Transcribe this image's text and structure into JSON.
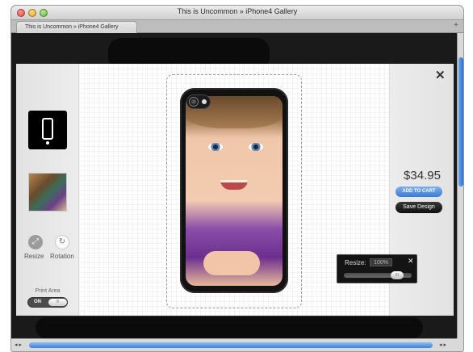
{
  "window": {
    "title": "This is Uncommon » iPhone4 Gallery"
  },
  "tabs": {
    "active_label": "This is Uncommon » iPhone4 Gallery",
    "add_symbol": "+"
  },
  "editor": {
    "close_symbol": "✕",
    "tools": {
      "resize_label": "Resize",
      "rotation_label": "Rotation",
      "resize_icon": "⤢",
      "rotation_icon": "↻"
    },
    "print_area": {
      "label": "Print Area",
      "toggle_on": "ON",
      "toggle_knob": "III",
      "state": "on"
    },
    "price": "$34.95",
    "add_to_cart_label": "ADD TO CART",
    "save_design_label": "Save Design"
  },
  "resize_popup": {
    "label": "Resize:",
    "value": "100%",
    "close_symbol": "✕",
    "slider_knob": "III",
    "slider_level": 0.85
  },
  "scrollbar": {
    "left_arrows": "◂ ▸",
    "right_arrows": "◂ ▸"
  },
  "colors": {
    "accent_blue": "#3b79d2",
    "dark_button": "#0f0f0f"
  }
}
